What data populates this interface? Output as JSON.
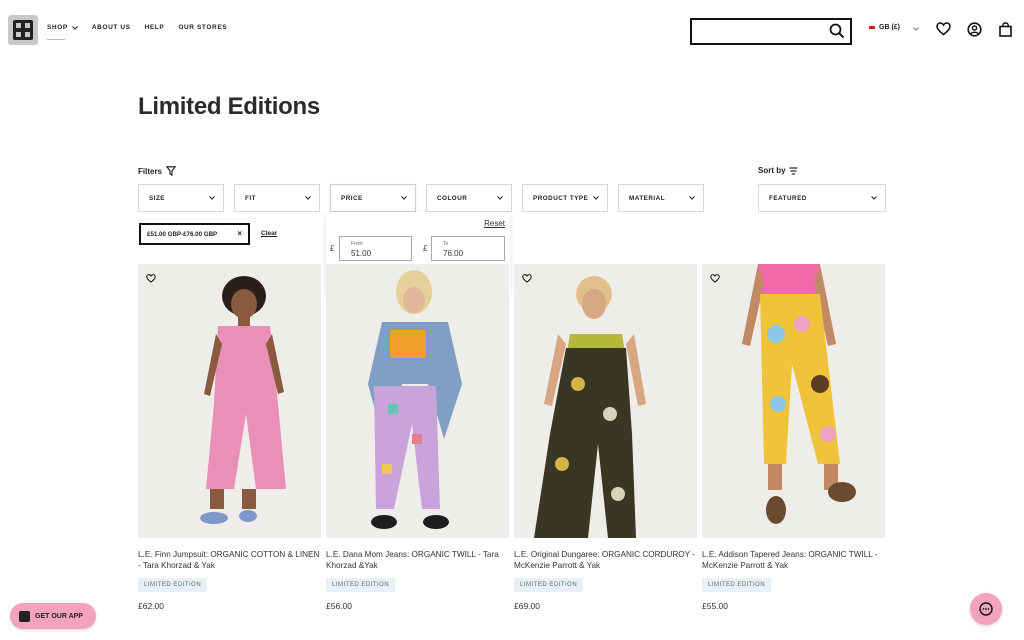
{
  "header": {
    "nav": [
      {
        "label": "SHOP",
        "has_dropdown": true
      },
      {
        "label": "ABOUT US"
      },
      {
        "label": "HELP"
      },
      {
        "label": "OUR STORES"
      }
    ],
    "search_placeholder": "",
    "currency": "GB (£)"
  },
  "page": {
    "title": "Limited Editions"
  },
  "filters": {
    "label": "Filters",
    "sort_label": "Sort by",
    "sort_value": "FEATURED",
    "boxes": [
      "SIZE",
      "FIT",
      "PRICE",
      "COLOUR",
      "PRODUCT TYPE",
      "MATERIAL"
    ],
    "active_chip": "£51.00 GBP-£76.00 GBP",
    "chip_close": "×",
    "clear_label": "Clear"
  },
  "price_panel": {
    "reset_label": "Reset",
    "currency_symbol": "£",
    "from_label": "From",
    "from_value": "51.00",
    "to_label": "To",
    "to_value": "76.00"
  },
  "products": [
    {
      "name": "L.E. Finn Jumpsuit: ORGANIC COTTON & LINEN - Tara Khorzad & Yak",
      "badge": "LIMITED EDITION",
      "price": "£62.00"
    },
    {
      "name": "L.E. Dana Mom Jeans: ORGANIC TWILL - Tara Khorzad &Yak",
      "badge": "LIMITED EDITION",
      "price": "£56.00"
    },
    {
      "name": "L.E. Original Dungaree: ORGANIC CORDUROY - McKenzie Parrott & Yak",
      "badge": "LIMITED EDITION",
      "price": "£69.00"
    },
    {
      "name": "L.E. Addison Tapered Jeans: ORGANIC TWILL - McKenzie Parrott & Yak",
      "badge": "LIMITED EDITION",
      "price": "£55.00"
    }
  ],
  "widgets": {
    "app_label": "GET OUR APP"
  },
  "colors": {
    "accent_pink": "#f5a2c0",
    "badge_bg": "#e8f0f6"
  }
}
